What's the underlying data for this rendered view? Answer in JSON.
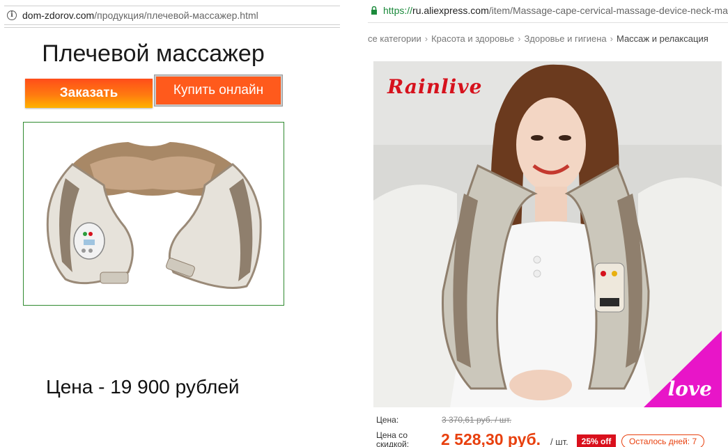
{
  "left": {
    "url_host": "dom-zdorov.com",
    "url_path": "/продукция/плечевой-массажер.html",
    "title": "Плечевой массажер",
    "order_button": "Заказать",
    "buy_button": "Купить онлайн",
    "price": "Цена - 19 900 рублей"
  },
  "right": {
    "url_scheme": "https://",
    "url_host": "ru.aliexpress.com",
    "url_path": "/item/Massage-cape-cervical-massage-device-neck-ma",
    "breadcrumb": [
      "се категории",
      "Красота и здоровье",
      "Здоровье и гигиена",
      "Массаж и релаксация"
    ],
    "brand": "Rainlive",
    "corner_text": "love",
    "price_label": "Цена:",
    "old_price": "3 370,61 руб. / шт.",
    "discount_label": "Цена со скидкой:",
    "new_price": "2 528,30 руб.",
    "unit": "/ шт.",
    "off_badge": "25% off",
    "days_left": "Осталось дней: 7"
  },
  "colors": {
    "accent_orange": "#ff5a1c",
    "price_red": "#e8400e",
    "brand_red": "#d6121d",
    "corner_magenta": "#e815c8",
    "frame_green": "#2f8a2f",
    "https_green": "#1c8a3c"
  },
  "icons": [
    "info-icon",
    "lock-icon"
  ]
}
